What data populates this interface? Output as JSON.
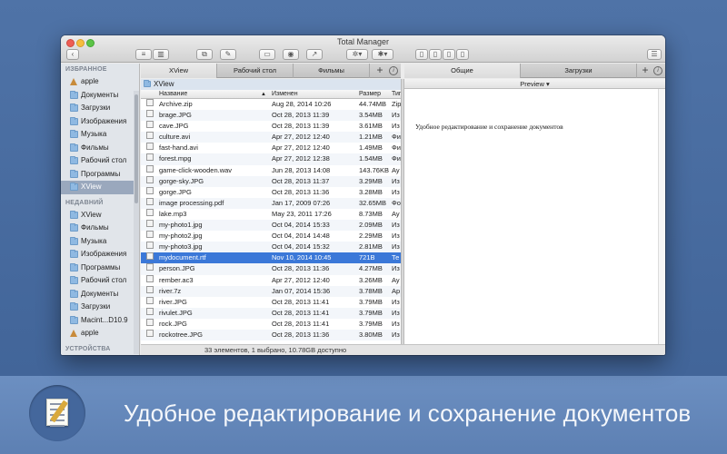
{
  "window": {
    "title": "Total Manager"
  },
  "sidebar": {
    "sections": [
      {
        "title": "ИЗБРАННОЕ",
        "items": [
          {
            "label": "apple",
            "icon": "home-icon",
            "selected": false
          },
          {
            "label": "Документы",
            "icon": "folder-icon",
            "selected": false
          },
          {
            "label": "Загрузки",
            "icon": "folder-icon",
            "selected": false
          },
          {
            "label": "Изображения",
            "icon": "folder-icon",
            "selected": false
          },
          {
            "label": "Музыка",
            "icon": "folder-icon",
            "selected": false
          },
          {
            "label": "Фильмы",
            "icon": "folder-icon",
            "selected": false
          },
          {
            "label": "Рабочий стол",
            "icon": "folder-icon",
            "selected": false
          },
          {
            "label": "Программы",
            "icon": "folder-icon",
            "selected": false
          },
          {
            "label": "XView",
            "icon": "folder-icon",
            "selected": true
          }
        ]
      },
      {
        "title": "НЕДАВНИЙ",
        "items": [
          {
            "label": "XView",
            "icon": "folder-icon",
            "selected": false
          },
          {
            "label": "Фильмы",
            "icon": "folder-icon",
            "selected": false
          },
          {
            "label": "Музыка",
            "icon": "folder-icon",
            "selected": false
          },
          {
            "label": "Изображения",
            "icon": "folder-icon",
            "selected": false
          },
          {
            "label": "Программы",
            "icon": "folder-icon",
            "selected": false
          },
          {
            "label": "Рабочий стол",
            "icon": "folder-icon",
            "selected": false
          },
          {
            "label": "Документы",
            "icon": "folder-icon",
            "selected": false
          },
          {
            "label": "Загрузки",
            "icon": "folder-icon",
            "selected": false
          },
          {
            "label": "Macint...D10.9",
            "icon": "folder-icon",
            "selected": false
          },
          {
            "label": "apple",
            "icon": "home-icon",
            "selected": false
          }
        ]
      },
      {
        "title": "УСТРОЙСТВА",
        "items": []
      }
    ]
  },
  "left_tabs": [
    "XView",
    "Рабочий стол",
    "Фильмы"
  ],
  "right_tabs": [
    "Общие",
    "Загрузки"
  ],
  "left_pane": {
    "path": "XView",
    "columns": [
      "Название",
      "Изменен",
      "Размер",
      "Тип"
    ],
    "rows": [
      {
        "name": "Archive.zip",
        "date": "Aug 28, 2014 10:26",
        "size": "44.74MB",
        "type": "Zip"
      },
      {
        "name": "brage.JPG",
        "date": "Oct 28, 2013 11:39",
        "size": "3.54MB",
        "type": "Из"
      },
      {
        "name": "cave.JPG",
        "date": "Oct 28, 2013 11:39",
        "size": "3.61MB",
        "type": "Из"
      },
      {
        "name": "culture.avi",
        "date": "Apr 27, 2012 12:40",
        "size": "1.21MB",
        "type": "Фи"
      },
      {
        "name": "fast-hand.avi",
        "date": "Apr 27, 2012 12:40",
        "size": "1.49MB",
        "type": "Фи"
      },
      {
        "name": "forest.mpg",
        "date": "Apr 27, 2012 12:38",
        "size": "1.54MB",
        "type": "Фи"
      },
      {
        "name": "game-click-wooden.wav",
        "date": "Jun 28, 2013 14:08",
        "size": "143.76KB",
        "type": "Ау"
      },
      {
        "name": "gorge-sky.JPG",
        "date": "Oct 28, 2013 11:37",
        "size": "3.29MB",
        "type": "Из"
      },
      {
        "name": "gorge.JPG",
        "date": "Oct 28, 2013 11:36",
        "size": "3.28MB",
        "type": "Из"
      },
      {
        "name": "image processing.pdf",
        "date": "Jan 17, 2009 07:26",
        "size": "32.65MB",
        "type": "Фо"
      },
      {
        "name": "lake.mp3",
        "date": "May 23, 2011 17:26",
        "size": "8.73MB",
        "type": "Ау"
      },
      {
        "name": "my-photo1.jpg",
        "date": "Oct 04, 2014 15:33",
        "size": "2.09MB",
        "type": "Из"
      },
      {
        "name": "my-photo2.jpg",
        "date": "Oct 04, 2014 14:48",
        "size": "2.29MB",
        "type": "Из"
      },
      {
        "name": "my-photo3.jpg",
        "date": "Oct 04, 2014 15:32",
        "size": "2.81MB",
        "type": "Из"
      },
      {
        "name": "mydocument.rtf",
        "date": "Nov 10, 2014 10:45",
        "size": "721B",
        "type": "Те"
      },
      {
        "name": "person.JPG",
        "date": "Oct 28, 2013 11:36",
        "size": "4.27MB",
        "type": "Из"
      },
      {
        "name": "rember.ac3",
        "date": "Apr 27, 2012 12:40",
        "size": "3.26MB",
        "type": "Ау"
      },
      {
        "name": "river.7z",
        "date": "Jan 07, 2014 15:36",
        "size": "3.78MB",
        "type": "Ар"
      },
      {
        "name": "river.JPG",
        "date": "Oct 28, 2013 11:41",
        "size": "3.79MB",
        "type": "Из"
      },
      {
        "name": "rivulet.JPG",
        "date": "Oct 28, 2013 11:41",
        "size": "3.79MB",
        "type": "Из"
      },
      {
        "name": "rock.JPG",
        "date": "Oct 28, 2013 11:41",
        "size": "3.79MB",
        "type": "Из"
      },
      {
        "name": "rockotree.JPG",
        "date": "Oct 28, 2013 11:36",
        "size": "3.80MB",
        "type": "Из"
      }
    ],
    "selected_index": 14
  },
  "status": "33 элементов, 1 выбрано, 10.78GB доступно",
  "right_pane": {
    "header": "Preview",
    "text": "Удобное редактирование и сохранение документов"
  },
  "caption": "Удобное редактирование и сохранение документов",
  "colors": {
    "background": "#47699d",
    "selection": "#3b78d8",
    "sidebar_selected": "#9aa8bd"
  }
}
